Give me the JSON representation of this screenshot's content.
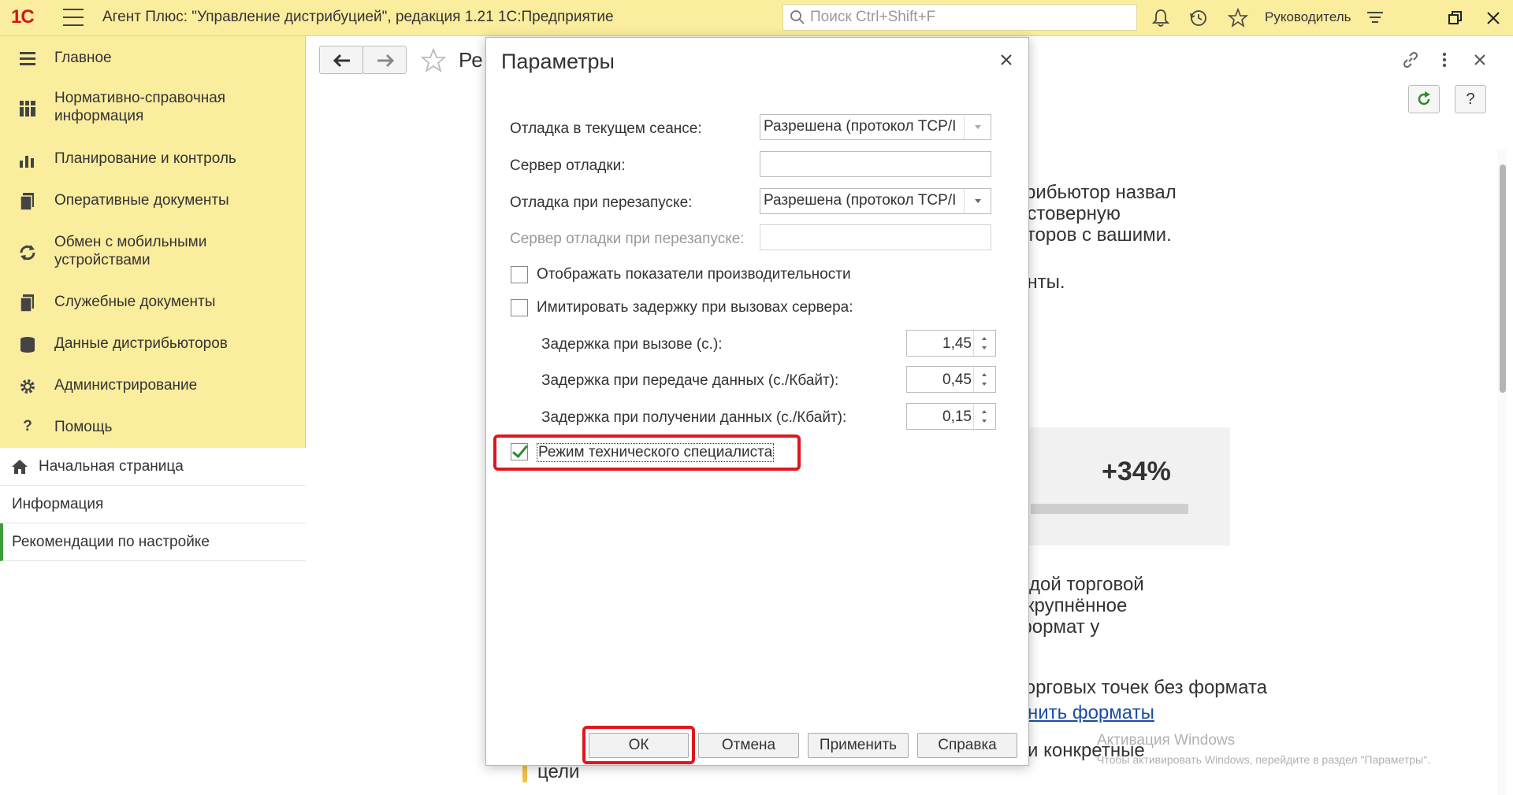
{
  "topbar": {
    "logo": "1С",
    "title": "Агент Плюс: \"Управление дистрибуцией\", редакция 1.21 1С:Предприятие",
    "search_placeholder": "Поиск Ctrl+Shift+F",
    "user": "Руководитель",
    "icons": [
      "bell-icon",
      "history-icon",
      "star-icon",
      "settings-lines-icon",
      "restore-icon",
      "close-icon"
    ]
  },
  "sidebar": {
    "items": [
      {
        "label": "Главное",
        "icon": "menu-lines-icon"
      },
      {
        "label": "Нормативно-справочная информация",
        "icon": "grid-icon"
      },
      {
        "label": "Планирование и контроль",
        "icon": "bar-chart-icon"
      },
      {
        "label": "Оперативные документы",
        "icon": "documents-icon"
      },
      {
        "label": "Обмен с мобильными устройствами",
        "icon": "sync-icon"
      },
      {
        "label": "Служебные документы",
        "icon": "documents-icon"
      },
      {
        "label": "Данные дистрибьюторов",
        "icon": "database-icon"
      },
      {
        "label": "Администрирование",
        "icon": "gear-icon"
      },
      {
        "label": "Помощь",
        "icon": "help-icon"
      }
    ],
    "nav": [
      {
        "label": "Начальная страница",
        "icon": "home-icon"
      },
      {
        "label": "Информация"
      },
      {
        "label": "Рекомендации по настройке",
        "active": true
      }
    ]
  },
  "content": {
    "page_title_fragment": "Ре",
    "text_lines": [
      "трибьютор назвал",
      "остоверную",
      "оторов с вашими.",
      "енты."
    ],
    "card_value": "+34%",
    "text_lines_2": [
      "ждой торговой",
      "укрупнённое",
      "формат у"
    ],
    "text_line_3": "торговых точек без формата",
    "link_text": "лнить форматы",
    "text_line_4": "ли конкретные",
    "text_line_5": "цели",
    "watermark_title": "Активация Windows",
    "watermark_sub": "Чтобы активировать Windows, перейдите в раздел \"Параметры\".",
    "help_button": "?"
  },
  "dialog": {
    "title": "Параметры",
    "debug_session_label": "Отладка в текущем сеансе:",
    "debug_session_value": "Разрешена (протокол TCP/I",
    "debug_server_label": "Сервер отладки:",
    "debug_restart_label": "Отладка при перезапуске:",
    "debug_restart_value": "Разрешена (протокол TCP/I",
    "debug_restart_server_label": "Сервер отладки при перезапуске:",
    "show_perf_label": "Отображать показатели производительности",
    "simulate_delay_label": "Имитировать задержку при вызовах сервера:",
    "call_delay_label": "Задержка при вызове (с.):",
    "call_delay_value": "1,45",
    "send_delay_label": "Задержка при передаче данных (с./Кбайт):",
    "send_delay_value": "0,45",
    "recv_delay_label": "Задержка при получении данных (с./Кбайт):",
    "recv_delay_value": "0,15",
    "tech_mode_label": "Режим технического специалиста",
    "ok_label": "ОК",
    "cancel_label": "Отмена",
    "apply_label": "Применить",
    "help_label": "Справка"
  },
  "colors": {
    "accent_yellow": "#fbed9e",
    "highlight_red": "#e0161e",
    "active_green": "#3b9b3b",
    "link_blue": "#1a4ea2"
  }
}
